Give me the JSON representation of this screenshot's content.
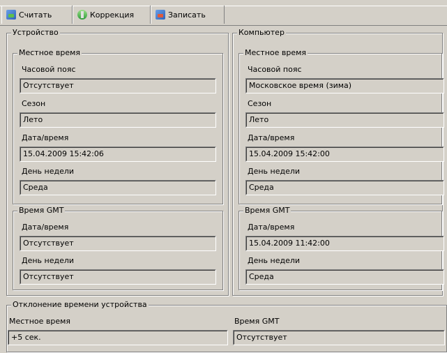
{
  "toolbar": {
    "read_label": "Считать",
    "correction_label": "Коррекция",
    "write_label": "Записать"
  },
  "device": {
    "title": "Устройство",
    "local": {
      "title": "Местное время",
      "timezone_label": "Часовой пояс",
      "timezone_value": "Отсутствует",
      "season_label": "Сезон",
      "season_value": "Лето",
      "datetime_label": "Дата/время",
      "datetime_value": "15.04.2009 15:42:06",
      "weekday_label": "День недели",
      "weekday_value": "Среда"
    },
    "gmt": {
      "title": "Время GMT",
      "datetime_label": "Дата/время",
      "datetime_value": "Отсутствует",
      "weekday_label": "День недели",
      "weekday_value": "Отсутствует"
    }
  },
  "computer": {
    "title": "Компьютер",
    "local": {
      "title": "Местное время",
      "timezone_label": "Часовой пояс",
      "timezone_value": "Московское время (зима)",
      "season_label": "Сезон",
      "season_value": "Лето",
      "datetime_label": "Дата/время",
      "datetime_value": "15.04.2009 15:42:00",
      "weekday_label": "День недели",
      "weekday_value": "Среда"
    },
    "gmt": {
      "title": "Время GMT",
      "datetime_label": "Дата/время",
      "datetime_value": "15.04.2009 11:42:00",
      "weekday_label": "День недели",
      "weekday_value": "Среда"
    }
  },
  "deviation": {
    "title": "Отклонение времени устройства",
    "local_label": "Местное время",
    "local_value": "+5 сек.",
    "gmt_label": "Время GMT",
    "gmt_value": "Отсутствует"
  }
}
